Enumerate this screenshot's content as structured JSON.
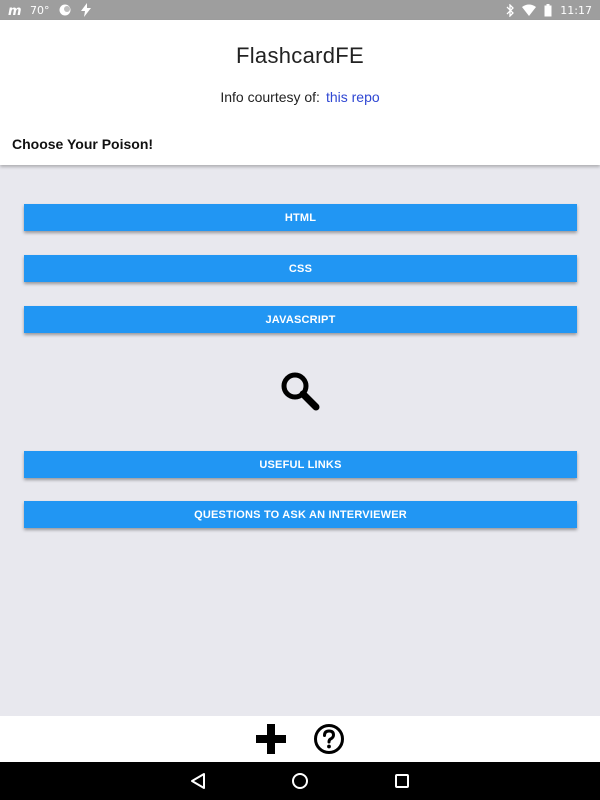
{
  "status_bar": {
    "temperature": "70°",
    "time": "11:17",
    "icons": [
      "m-app-icon",
      "weather-icon",
      "flash-icon",
      "bluetooth-icon",
      "wifi-icon",
      "battery-icon"
    ]
  },
  "header": {
    "title": "FlashcardFE",
    "courtesy_text": "Info courtesy of:",
    "courtesy_link": "this repo",
    "subtitle": "Choose Your Poison!"
  },
  "buttons": {
    "html": "HTML",
    "css": "CSS",
    "javascript": "JAVASCRIPT",
    "useful_links": "USEFUL LINKS",
    "questions": "QUESTIONS TO ASK AN INTERVIEWER"
  },
  "toolbar": {
    "icons": [
      "add-icon",
      "help-icon"
    ]
  },
  "navbar": {
    "icons": [
      "back-icon",
      "home-icon",
      "recents-icon"
    ]
  },
  "colors": {
    "accent": "#2196f3",
    "link": "#2f47d3",
    "background": "#e8e8ee",
    "statusbar": "#9e9e9e"
  }
}
